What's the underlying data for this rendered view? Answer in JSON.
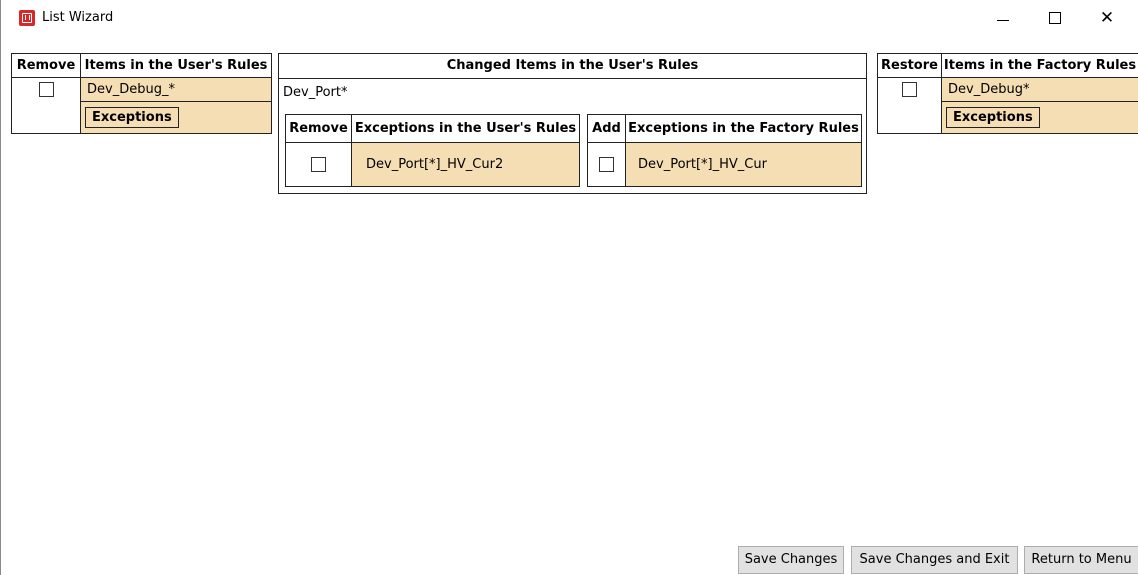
{
  "window": {
    "title": "List Wizard"
  },
  "left": {
    "col_remove": "Remove",
    "col_items": "Items in the User's Rules",
    "item_name": "Dev_Debug_*",
    "exceptions_label": "Exceptions"
  },
  "middle": {
    "header": "Changed Items in the User's Rules",
    "item_name": "Dev_Port*",
    "user_exceptions": {
      "col_remove": "Remove",
      "col_items": "Exceptions in the User's Rules",
      "row_value": "Dev_Port[*]_HV_Cur2"
    },
    "factory_exceptions": {
      "col_add": "Add",
      "col_items": "Exceptions in the Factory Rules",
      "row_value": "Dev_Port[*]_HV_Cur"
    }
  },
  "right": {
    "col_restore": "Restore",
    "col_items": "Items in the Factory Rules",
    "item_name": "Dev_Debug*",
    "exceptions_label": "Exceptions"
  },
  "footer": {
    "save_label": "Save Changes",
    "save_exit_label": "Save Changes and Exit",
    "return_label": "Return to Menu"
  },
  "colors": {
    "highlight": "#f5deb3"
  }
}
